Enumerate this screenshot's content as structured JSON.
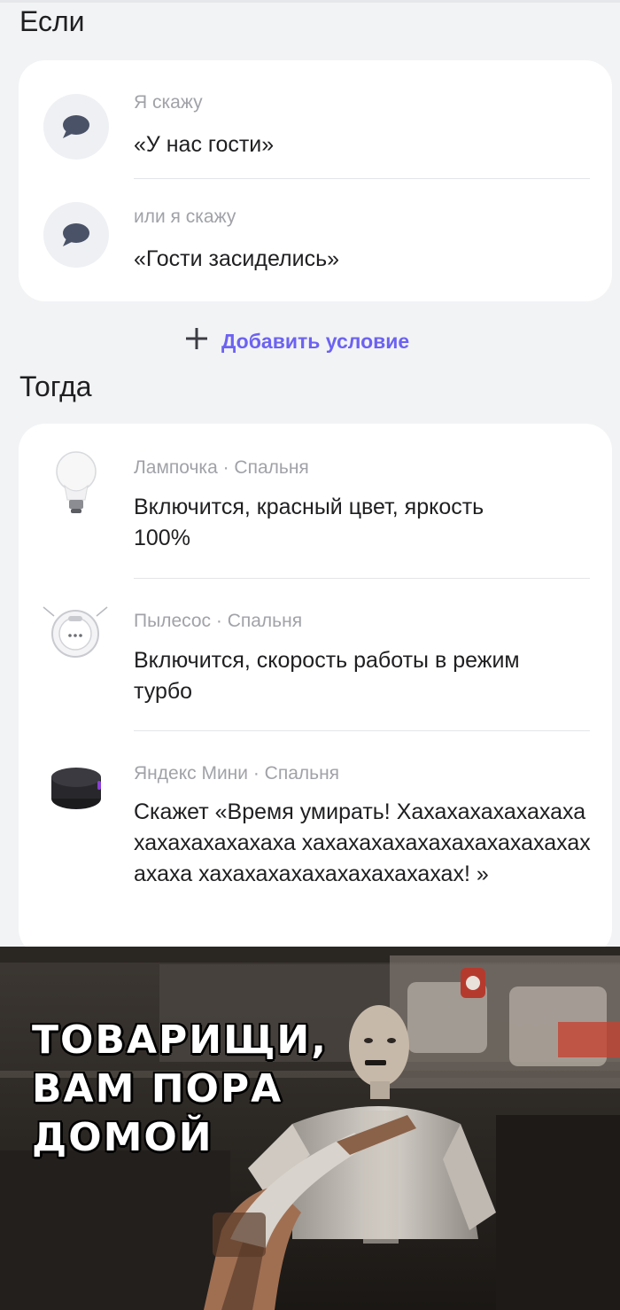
{
  "if_section": {
    "title": "Если",
    "conditions": [
      {
        "label": "Я скажу",
        "phrase": "«У нас гости»",
        "icon": "speech-bubble-icon"
      },
      {
        "label": "или я скажу",
        "phrase": "«Гости засиделись»",
        "icon": "speech-bubble-icon"
      }
    ],
    "add_condition_label": "Добавить условие"
  },
  "then_section": {
    "title": "Тогда",
    "actions": [
      {
        "device": "Лампочка · Спальня",
        "description": "Включится, красный цвет, яркость 100%",
        "icon": "light-bulb-icon"
      },
      {
        "device": "Пылесос · Спальня",
        "description": "Включится, скорость работы в режим турбо",
        "icon": "robot-vacuum-icon"
      },
      {
        "device": "Яндекс Мини · Спальня",
        "description": "Скажет «Время умирать! Хахахахахахахахахахахахахахаха хахахахахахахахахахахахахахаха хахахахахахахахахахахах! »",
        "icon": "smart-speaker-icon"
      }
    ]
  },
  "meme": {
    "caption_lines": [
      "ТОВАРИЩИ,",
      "ВАМ ПОРА",
      "ДОМОЙ"
    ]
  },
  "colors": {
    "background": "#f2f3f5",
    "card": "#ffffff",
    "accent": "#6c62f2",
    "secondary_text": "#a1a2a8",
    "primary_text": "#1f1f21"
  }
}
